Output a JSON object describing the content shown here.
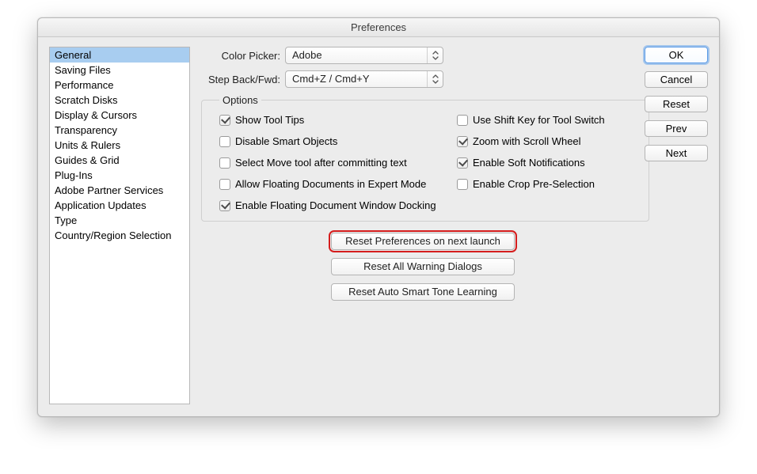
{
  "window": {
    "title": "Preferences"
  },
  "sidebar": {
    "items": [
      {
        "label": "General",
        "selected": true
      },
      {
        "label": "Saving Files"
      },
      {
        "label": "Performance"
      },
      {
        "label": "Scratch Disks"
      },
      {
        "label": "Display & Cursors"
      },
      {
        "label": "Transparency"
      },
      {
        "label": "Units & Rulers"
      },
      {
        "label": "Guides & Grid"
      },
      {
        "label": "Plug-Ins"
      },
      {
        "label": "Adobe Partner Services"
      },
      {
        "label": "Application Updates"
      },
      {
        "label": "Type"
      },
      {
        "label": "Country/Region Selection"
      }
    ]
  },
  "form": {
    "color_picker": {
      "label": "Color Picker:",
      "value": "Adobe"
    },
    "step_back_fwd": {
      "label": "Step Back/Fwd:",
      "value": "Cmd+Z / Cmd+Y"
    }
  },
  "options": {
    "legend": "Options",
    "left": [
      {
        "label": "Show Tool Tips",
        "checked": true
      },
      {
        "label": "Disable Smart Objects",
        "checked": false
      },
      {
        "label": "Select Move tool after committing text",
        "checked": false
      },
      {
        "label": "Allow Floating Documents in Expert Mode",
        "checked": false
      },
      {
        "label": "Enable Floating Document Window Docking",
        "checked": true
      }
    ],
    "right": [
      {
        "label": "Use Shift Key for Tool Switch",
        "checked": false
      },
      {
        "label": "Zoom with Scroll Wheel",
        "checked": true
      },
      {
        "label": "Enable Soft Notifications",
        "checked": true
      },
      {
        "label": "Enable Crop Pre-Selection",
        "checked": false
      }
    ]
  },
  "reset_buttons": {
    "reset_prefs": "Reset Preferences on next launch",
    "reset_warnings": "Reset All Warning Dialogs",
    "reset_smart_tone": "Reset Auto Smart Tone Learning"
  },
  "actions": {
    "ok": "OK",
    "cancel": "Cancel",
    "reset": "Reset",
    "prev": "Prev",
    "next": "Next"
  },
  "highlight": {
    "reset_prefs": true
  }
}
